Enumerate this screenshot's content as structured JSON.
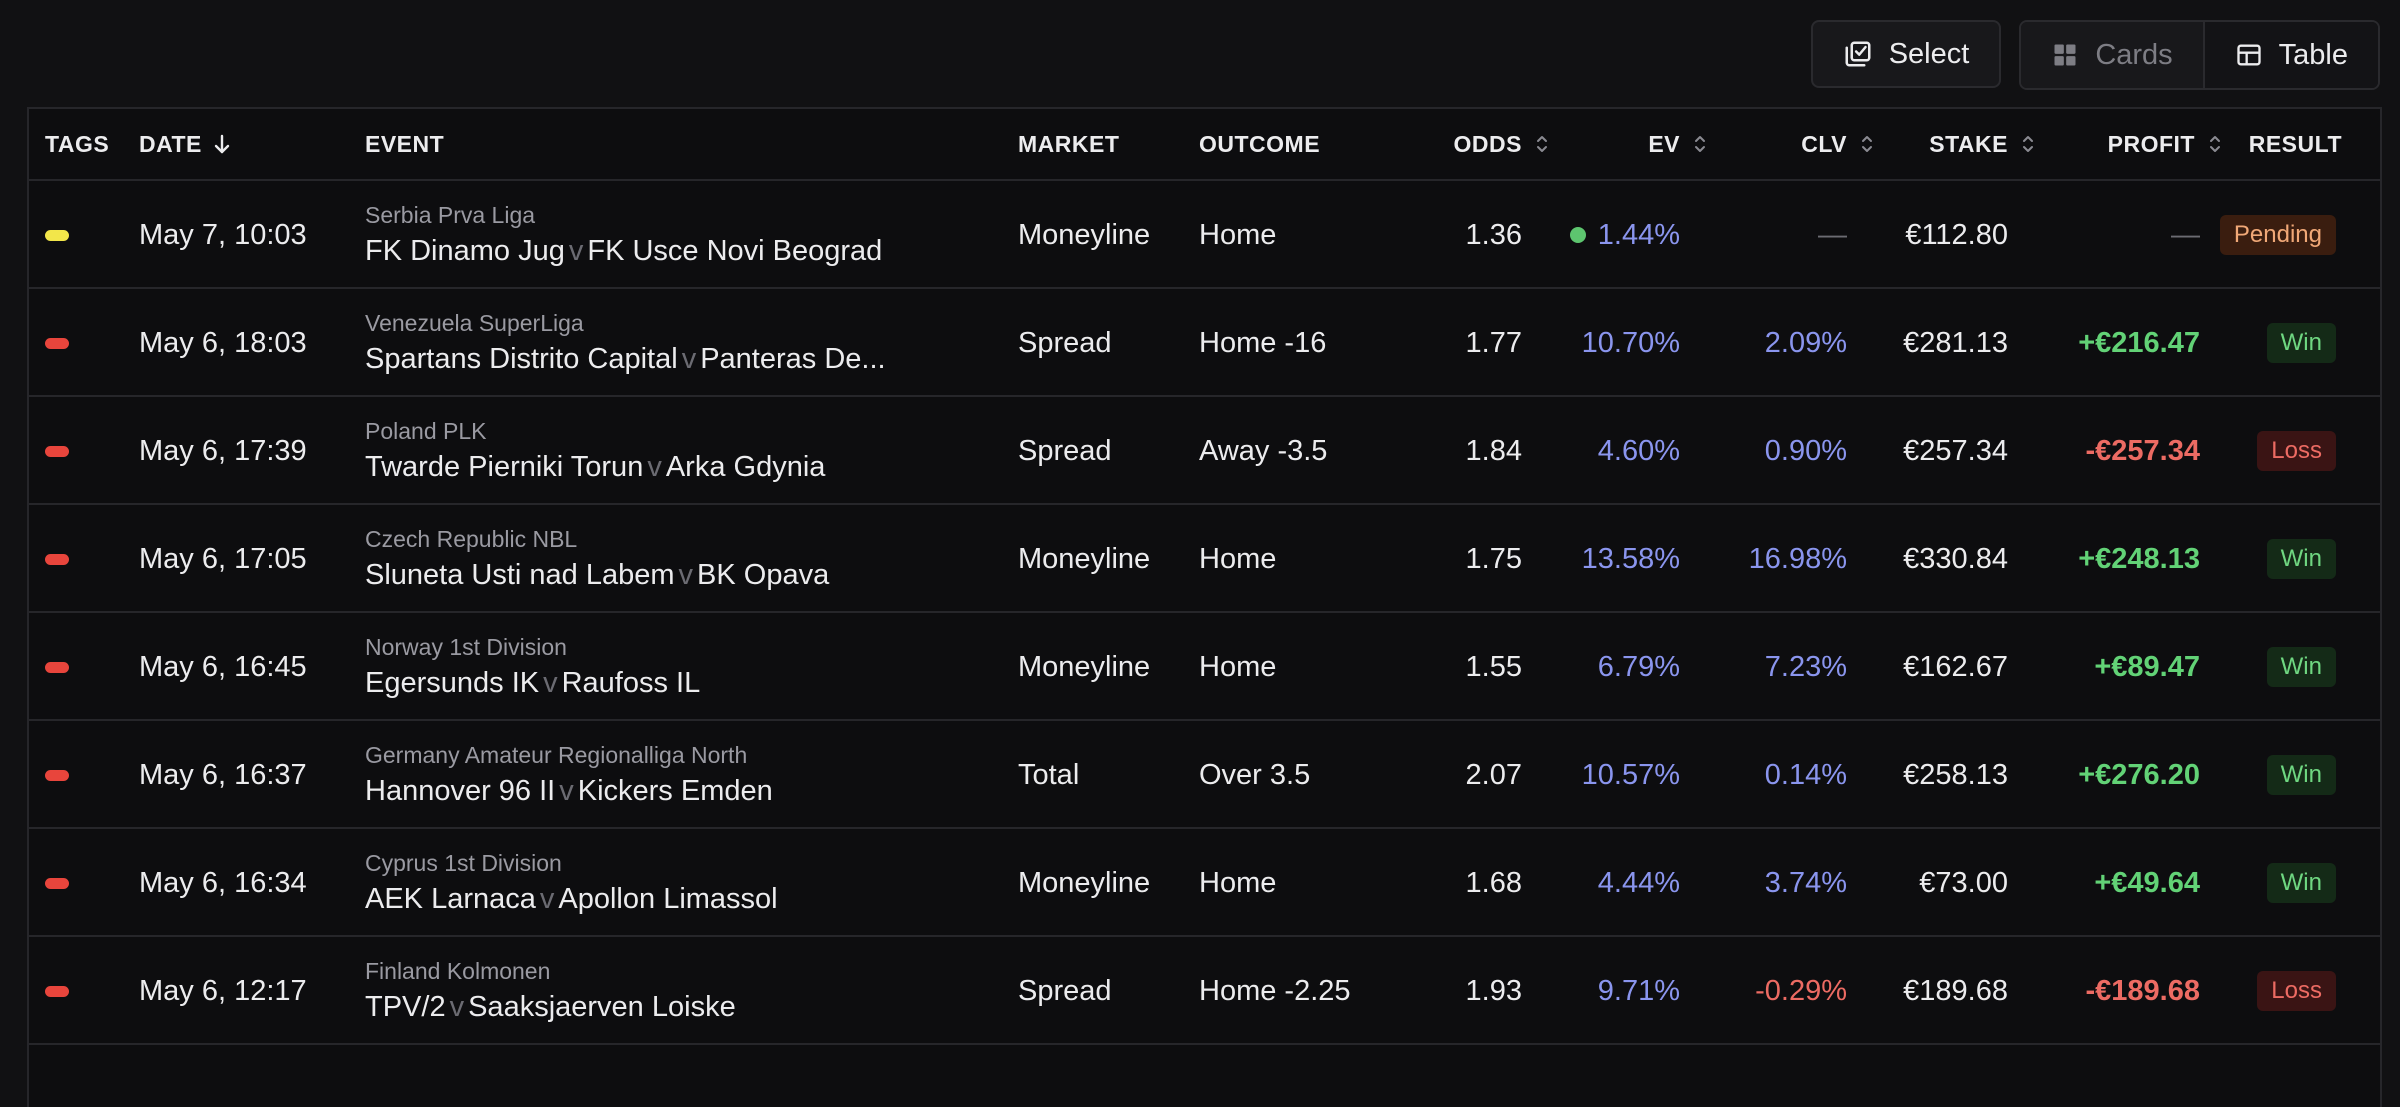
{
  "toolbar": {
    "select_label": "Select",
    "cards_label": "Cards",
    "table_label": "Table",
    "active_view": "Table"
  },
  "columns": {
    "tags": "TAGS",
    "date": "DATE",
    "event": "EVENT",
    "market": "MARKET",
    "outcome": "OUTCOME",
    "odds": "ODDS",
    "ev": "EV",
    "clv": "CLV",
    "stake": "STAKE",
    "profit": "PROFIT",
    "result": "RESULT"
  },
  "colors": {
    "tag_yellow": "#f2e64a",
    "tag_red": "#e8453c"
  },
  "rows": [
    {
      "tag_color": "#f2e64a",
      "date": "May 7, 10:03",
      "league": "Serbia Prva Liga",
      "home": "FK Dinamo Jug",
      "away": "FK Usce Novi Beograd",
      "market": "Moneyline",
      "outcome": "Home",
      "odds": "1.36",
      "ev": "1.44%",
      "clv": "—",
      "stake": "€112.80",
      "profit": "—",
      "result": "Pending"
    },
    {
      "tag_color": "#e8453c",
      "date": "May 6, 18:03",
      "league": "Venezuela SuperLiga",
      "home": "Spartans Distrito Capital",
      "away": "Panteras De...",
      "market": "Spread",
      "outcome": "Home -16",
      "odds": "1.77",
      "ev": "10.70%",
      "clv": "2.09%",
      "stake": "€281.13",
      "profit": "+€216.47",
      "result": "Win"
    },
    {
      "tag_color": "#e8453c",
      "date": "May 6, 17:39",
      "league": "Poland PLK",
      "home": "Twarde Pierniki Torun",
      "away": "Arka Gdynia",
      "market": "Spread",
      "outcome": "Away -3.5",
      "odds": "1.84",
      "ev": "4.60%",
      "clv": "0.90%",
      "stake": "€257.34",
      "profit": "-€257.34",
      "result": "Loss"
    },
    {
      "tag_color": "#e8453c",
      "date": "May 6, 17:05",
      "league": "Czech Republic NBL",
      "home": "Sluneta Usti nad Labem",
      "away": "BK Opava",
      "market": "Moneyline",
      "outcome": "Home",
      "odds": "1.75",
      "ev": "13.58%",
      "clv": "16.98%",
      "stake": "€330.84",
      "profit": "+€248.13",
      "result": "Win"
    },
    {
      "tag_color": "#e8453c",
      "date": "May 6, 16:45",
      "league": "Norway 1st Division",
      "home": "Egersunds IK",
      "away": "Raufoss IL",
      "market": "Moneyline",
      "outcome": "Home",
      "odds": "1.55",
      "ev": "6.79%",
      "clv": "7.23%",
      "stake": "€162.67",
      "profit": "+€89.47",
      "result": "Win"
    },
    {
      "tag_color": "#e8453c",
      "date": "May 6, 16:37",
      "league": "Germany Amateur Regionalliga North",
      "home": "Hannover 96 II",
      "away": "Kickers Emden",
      "market": "Total",
      "outcome": "Over 3.5",
      "odds": "2.07",
      "ev": "10.57%",
      "clv": "0.14%",
      "stake": "€258.13",
      "profit": "+€276.20",
      "result": "Win"
    },
    {
      "tag_color": "#e8453c",
      "date": "May 6, 16:34",
      "league": "Cyprus 1st Division",
      "home": "AEK Larnaca",
      "away": "Apollon Limassol",
      "market": "Moneyline",
      "outcome": "Home",
      "odds": "1.68",
      "ev": "4.44%",
      "clv": "3.74%",
      "stake": "€73.00",
      "profit": "+€49.64",
      "result": "Win"
    },
    {
      "tag_color": "#e8453c",
      "date": "May 6, 12:17",
      "league": "Finland Kolmonen",
      "home": "TPV/2",
      "away": "Saaksjaerven Loiske",
      "market": "Spread",
      "outcome": "Home -2.25",
      "odds": "1.93",
      "ev": "9.71%",
      "clv": "-0.29%",
      "stake": "€189.68",
      "profit": "-€189.68",
      "result": "Loss"
    }
  ],
  "vs_label": "v"
}
